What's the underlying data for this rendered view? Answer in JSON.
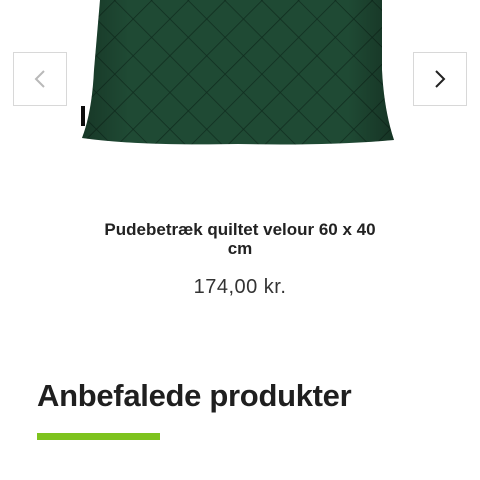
{
  "colors": {
    "pillow": "#1f4a34",
    "pillow_dark": "#163a28",
    "accent_underline": "#7ec31e",
    "nav_border": "#d8d8d8"
  },
  "carousel": {
    "prev_icon": "chevron-left-icon",
    "next_icon": "chevron-right-icon"
  },
  "product": {
    "title": "Pudebetræk quiltet velour 60 x 40 cm",
    "price": "174,00 kr."
  },
  "recommended": {
    "heading": "Anbefalede produkter"
  }
}
